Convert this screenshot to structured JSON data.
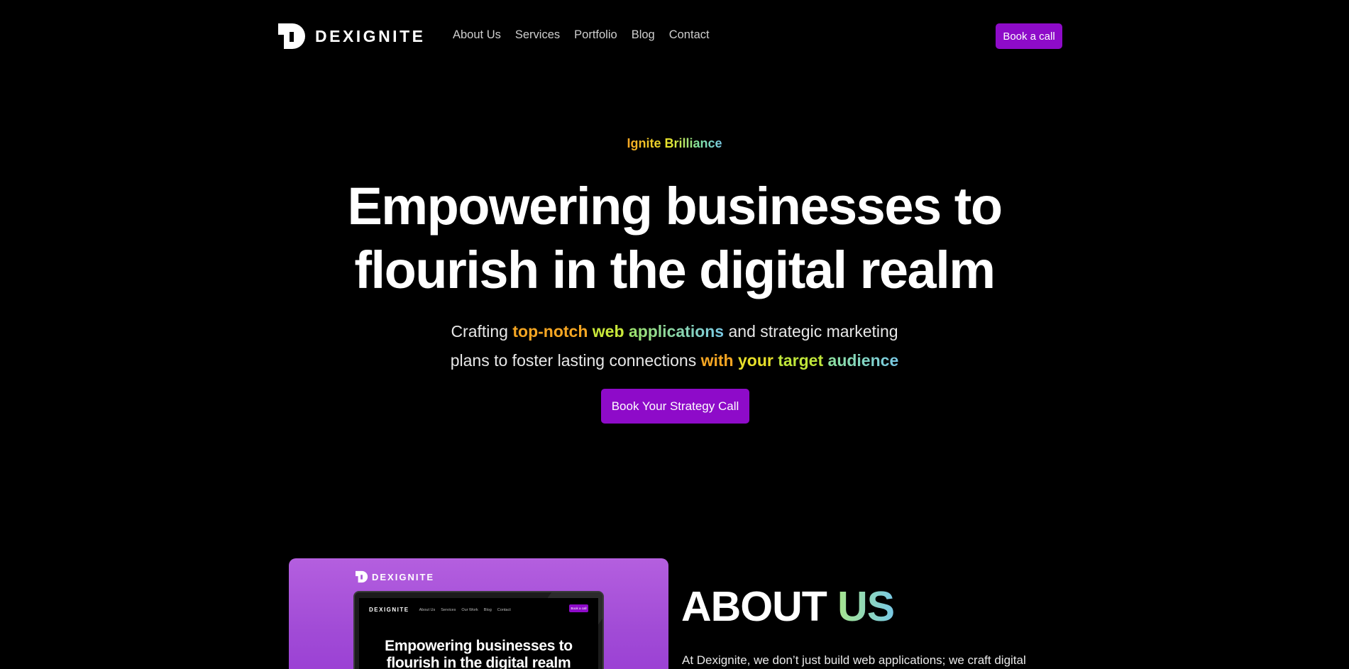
{
  "nav": {
    "brand": "DEXIGNITE",
    "links": [
      "About Us",
      "Services",
      "Portfolio",
      "Blog",
      "Contact"
    ],
    "cta": "Book a call"
  },
  "hero": {
    "eyebrow": "Ignite Brilliance",
    "title_line1": "Empowering businesses to",
    "title_line2": "flourish in the digital realm",
    "sub": {
      "p1": "Crafting ",
      "h1": "top-notch",
      "h2": " web ",
      "h3": "applications",
      "p2": " and strategic marketing",
      "p3": "plans to foster lasting connections ",
      "h4": "with",
      "h5": " your ",
      "h6": "target",
      "h7": " audience"
    },
    "cta": "Book Your Strategy Call"
  },
  "about": {
    "card_brand": "DEXIGNITE",
    "mockup": {
      "brand": "DEXIGNITE",
      "links": [
        "About Us",
        "Services",
        "Our Work",
        "Blog",
        "Contact"
      ],
      "cta": "Book a call",
      "title_line1": "Empowering businesses to",
      "title_line2": "flourish in the digital realm"
    },
    "heading_a": "ABOUT ",
    "heading_b": "US",
    "text": "At Dexignite, we don’t just build web applications; we craft digital"
  },
  "colors": {
    "accent": "#8e0bc9",
    "background": "#000000",
    "card": "#a14bd6"
  }
}
